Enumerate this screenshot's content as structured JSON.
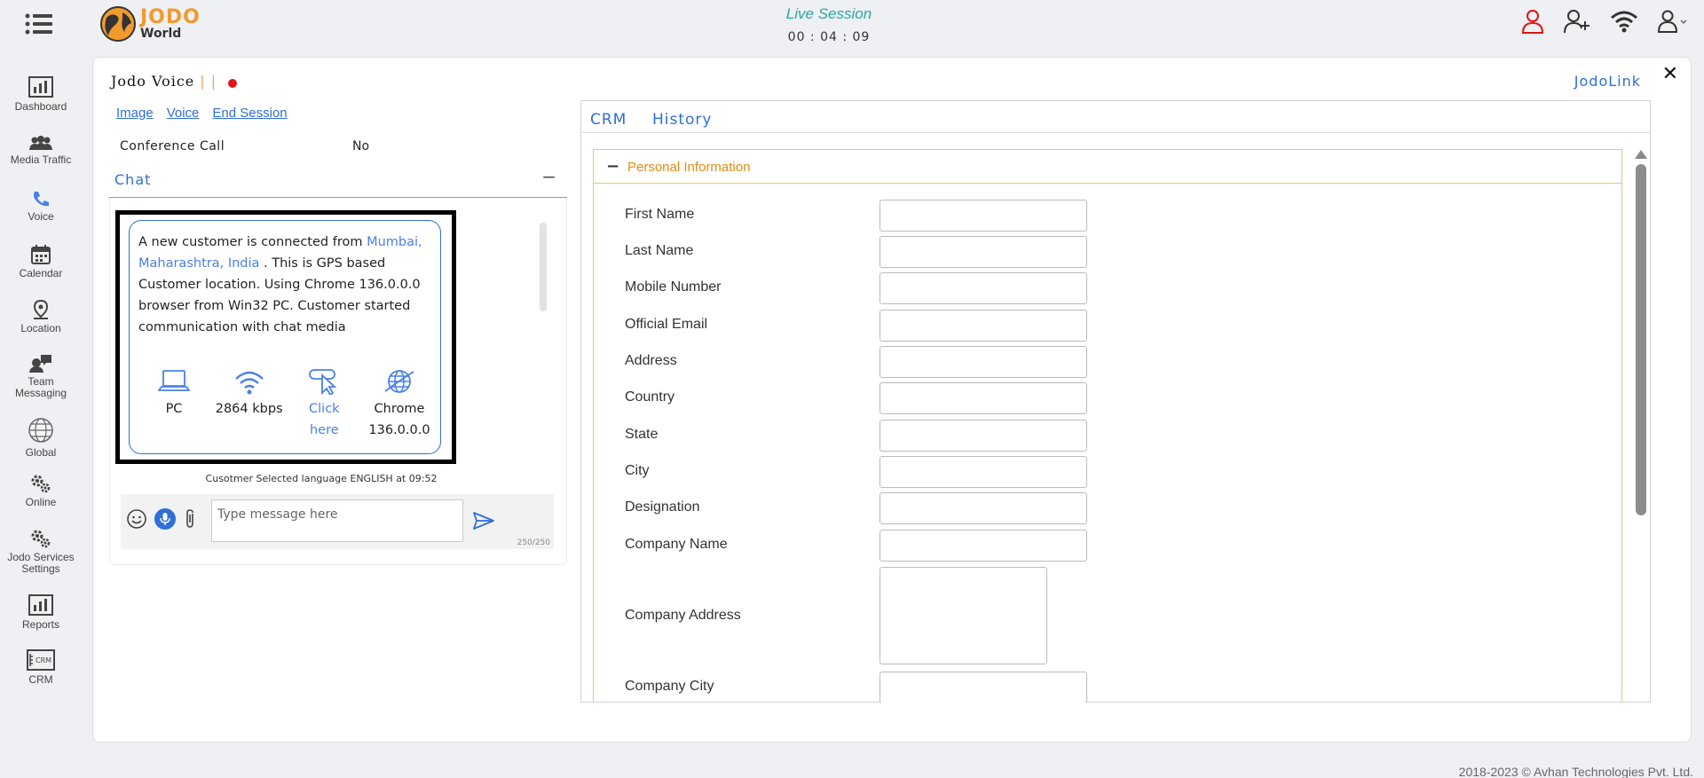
{
  "header": {
    "logo_top": "JODO",
    "logo_bottom": "World",
    "session_title": "Live Session",
    "session_timer": "00 : 04 : 09"
  },
  "sidebar": {
    "items": [
      {
        "label": "Dashboard",
        "icon": "dashboard-icon"
      },
      {
        "label": "Media Traffic",
        "icon": "media-traffic-icon"
      },
      {
        "label": "Voice",
        "icon": "phone-icon"
      },
      {
        "label": "Calendar",
        "icon": "calendar-icon"
      },
      {
        "label": "Location",
        "icon": "location-pin-icon"
      },
      {
        "label": "Team Messaging",
        "icon": "team-messaging-icon"
      },
      {
        "label": "Global",
        "icon": "globe-icon"
      },
      {
        "label": "Online",
        "icon": "gears-icon"
      },
      {
        "label": "Jodo Services Settings",
        "icon": "gears-icon"
      },
      {
        "label": "Reports",
        "icon": "reports-icon"
      },
      {
        "label": "CRM",
        "icon": "crm-icon"
      }
    ]
  },
  "voice": {
    "title": "Jodo Voice",
    "bars": "| |",
    "links": [
      "Image",
      "Voice",
      "End Session"
    ],
    "conference_label": "Conference Call",
    "conference_value": "No"
  },
  "jodolink": "JodoLink",
  "chat": {
    "title": "Chat",
    "minimize": "−",
    "message": {
      "p1": "A new customer is connected from ",
      "location": "Mumbai, Maharashtra, India",
      "p2": " . This is GPS based Customer location. Using Chrome 136.0.0.0 browser from Win32 PC. Customer started communication with chat media"
    },
    "device": "PC",
    "bandwidth": "2864 kbps",
    "click_label": "Click here",
    "browser": "Chrome 136.0.0.0",
    "language_note": "Cusotmer Selected language ENGLISH at 09:52",
    "input_placeholder": "Type message here",
    "counter": "250/250"
  },
  "crm": {
    "tabs": [
      "CRM",
      "History"
    ],
    "section_title": "Personal Information",
    "fields": [
      "First Name",
      "Last Name",
      "Mobile Number",
      "Official Email",
      "Address",
      "Country",
      "State",
      "City",
      "Designation",
      "Company Name",
      "Company Address",
      "Company City"
    ]
  },
  "footer": "2018-2023 © Avhan Technologies Pvt. Ltd.",
  "colors": {
    "accent": "#2f6fd6",
    "orange": "#e58a12",
    "teal": "#2aa79b",
    "red": "#e01414"
  }
}
